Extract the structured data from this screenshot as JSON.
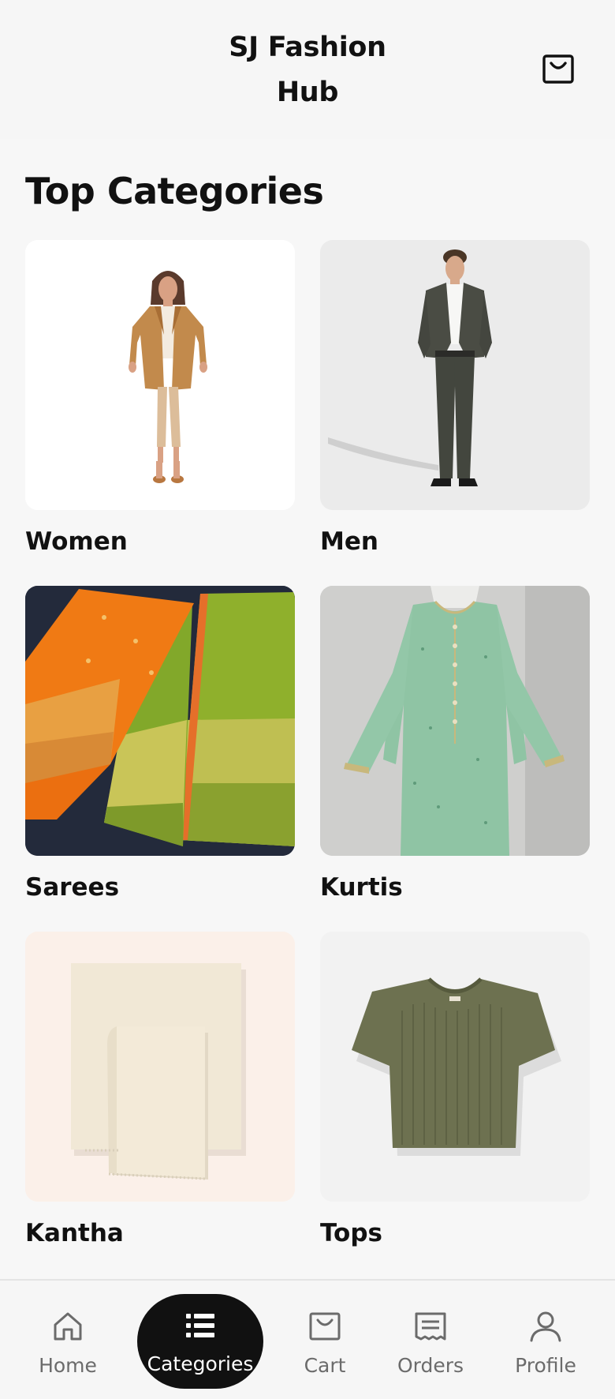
{
  "header": {
    "title": "SJ Fashion Hub",
    "cart_icon": "shopping-bag-icon"
  },
  "main": {
    "section_title": "Top Categories",
    "categories": [
      {
        "label": "Women",
        "image": "woman-in-camel-coat-illustration"
      },
      {
        "label": "Men",
        "image": "man-in-olive-suit-photo"
      },
      {
        "label": "Sarees",
        "image": "folded-orange-and-green-sarees-photo"
      },
      {
        "label": "Kurtis",
        "image": "mint-green-printed-kurti-on-mannequin-photo"
      },
      {
        "label": "Kantha",
        "image": "folded-cream-kantha-fabric-photo"
      },
      {
        "label": "Tops",
        "image": "olive-ribbed-tshirt-photo"
      }
    ]
  },
  "bottom_nav": {
    "active": "Categories",
    "items": [
      {
        "label": "Home",
        "icon": "home-icon"
      },
      {
        "label": "Categories",
        "icon": "list-icon"
      },
      {
        "label": "Cart",
        "icon": "shopping-bag-icon"
      },
      {
        "label": "Orders",
        "icon": "receipt-icon"
      },
      {
        "label": "Profile",
        "icon": "user-icon"
      }
    ]
  },
  "colors": {
    "background": "#f7f7f7",
    "text": "#111111",
    "nav_active_bg": "#111111",
    "nav_inactive_text": "#6b6b6b"
  }
}
